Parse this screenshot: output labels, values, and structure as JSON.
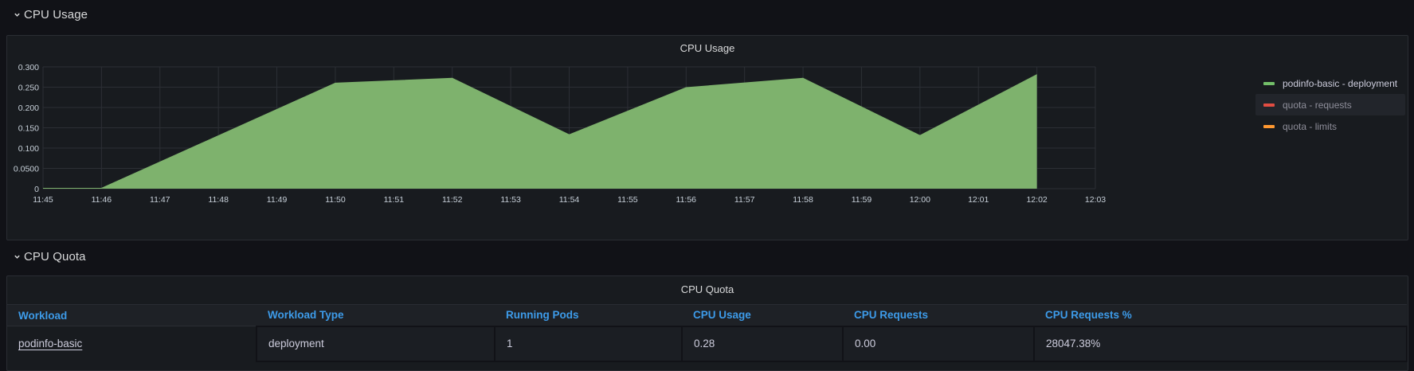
{
  "rows": {
    "usage": {
      "title": "CPU Usage",
      "chevron": "chevron-down-icon"
    },
    "quota": {
      "title": "CPU Quota",
      "chevron": "chevron-down-icon"
    }
  },
  "usage_panel": {
    "title": "CPU Usage"
  },
  "chart_data": {
    "type": "area",
    "title": "CPU Usage",
    "xlabel": "",
    "ylabel": "",
    "x": [
      "11:45",
      "11:46",
      "11:47",
      "11:48",
      "11:49",
      "11:50",
      "11:51",
      "11:52",
      "11:53",
      "11:54",
      "11:55",
      "11:56",
      "11:57",
      "11:58",
      "11:59",
      "12:00",
      "12:01",
      "12:02",
      "12:03"
    ],
    "ylim": [
      0,
      0.3
    ],
    "yticks": [
      "0",
      "0.0500",
      "0.100",
      "0.150",
      "0.200",
      "0.250",
      "0.300"
    ],
    "grid": true,
    "legend_placement": "right",
    "series": [
      {
        "name": "podinfo-basic - deployment",
        "color": "#7eb26d",
        "points": [
          {
            "x": "11:45",
            "y": 0.001
          },
          {
            "x": "11:46",
            "y": 0.001
          },
          {
            "x": "11:50",
            "y": 0.26
          },
          {
            "x": "11:52",
            "y": 0.272
          },
          {
            "x": "11:54",
            "y": 0.133
          },
          {
            "x": "11:56",
            "y": 0.249
          },
          {
            "x": "11:58",
            "y": 0.272
          },
          {
            "x": "12:00",
            "y": 0.131
          },
          {
            "x": "12:02",
            "y": 0.281
          }
        ]
      },
      {
        "name": "quota - requests",
        "color": "#e24d42",
        "points": []
      },
      {
        "name": "quota - limits",
        "color": "#f9934e",
        "points": []
      }
    ]
  },
  "legend": [
    {
      "label": "podinfo-basic - deployment",
      "color": "#73bf69"
    },
    {
      "label": "quota - requests",
      "color": "#e24d42"
    },
    {
      "label": "quota - limits",
      "color": "#ff9830"
    }
  ],
  "quota_panel": {
    "title": "CPU Quota",
    "columns": [
      "Workload",
      "Workload Type",
      "Running Pods",
      "CPU Usage",
      "CPU Requests",
      "CPU Requests %"
    ],
    "rows": [
      [
        "podinfo-basic",
        "deployment",
        "1",
        "0.28",
        "0.00",
        "28047.38%"
      ]
    ]
  }
}
